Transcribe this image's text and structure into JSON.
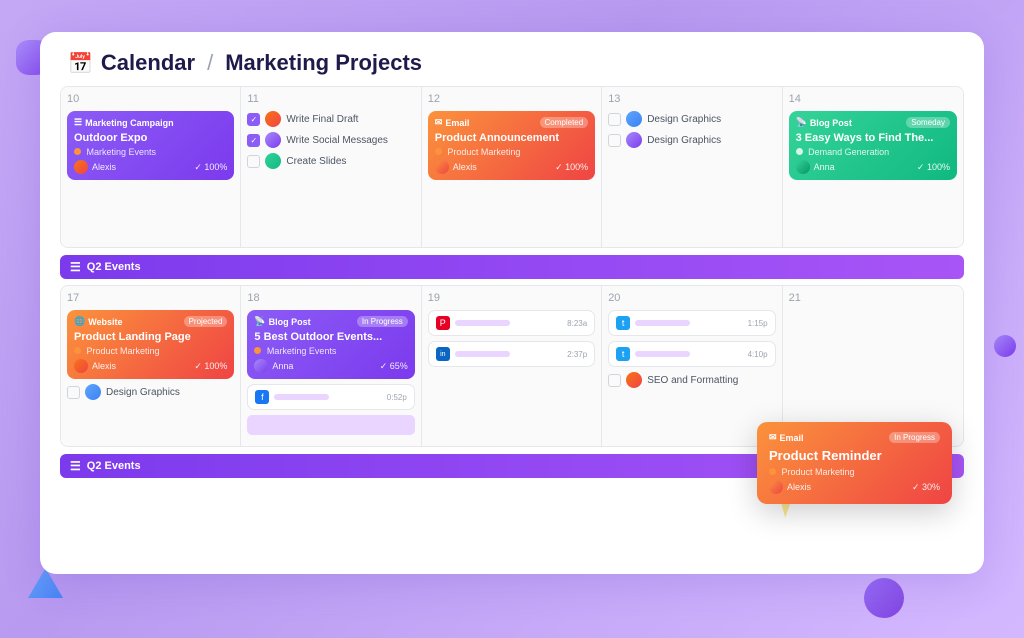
{
  "header": {
    "icon": "📅",
    "breadcrumb_sep": "/",
    "calendar_label": "Calendar",
    "project_label": "Marketing Projects"
  },
  "week1": {
    "days": [
      {
        "num": "10",
        "cards": [
          {
            "type": "purple",
            "icon": "☰",
            "type_label": "Marketing Campaign",
            "title": "Outdoor Expo",
            "sub": "Marketing Events",
            "avatar_name": "Alexis",
            "progress": "100%"
          }
        ]
      },
      {
        "num": "11",
        "checklist": [
          {
            "checked": true,
            "label": "Write Final Draft"
          },
          {
            "checked": true,
            "label": "Write Social Messages"
          },
          {
            "checked": false,
            "label": "Create Slides"
          }
        ]
      },
      {
        "num": "12",
        "cards": [
          {
            "type": "orange",
            "icon": "✉",
            "type_label": "Email",
            "badge": "Completed",
            "title": "Product Announcement",
            "sub": "Product Marketing",
            "avatar_name": "Alexis",
            "progress": "100%"
          }
        ]
      },
      {
        "num": "13",
        "tasks": [
          {
            "label": "Design Graphics"
          },
          {
            "label": "Design Graphics"
          }
        ]
      },
      {
        "num": "14",
        "cards": [
          {
            "type": "green",
            "icon": "📡",
            "type_label": "Blog Post",
            "badge": "Someday",
            "title": "3 Easy Ways to Find The...",
            "sub": "Demand Generation",
            "avatar_name": "Anna",
            "progress": "100%"
          }
        ]
      }
    ],
    "q2_banner": "Q2 Events"
  },
  "week2": {
    "days": [
      {
        "num": "17",
        "cards": [
          {
            "type": "orange",
            "icon": "🌐",
            "type_label": "Website",
            "badge": "Projected",
            "title": "Product Landing Page",
            "sub": "Product Marketing",
            "avatar_name": "Alexis",
            "progress": "100%"
          }
        ],
        "tasks": [
          {
            "label": "Design Graphics"
          }
        ]
      },
      {
        "num": "18",
        "cards": [
          {
            "type": "purple",
            "icon": "📡",
            "type_label": "Blog Post",
            "badge": "In Progress",
            "title": "5 Best Outdoor Events...",
            "sub": "Marketing Events",
            "avatar_name": "Anna",
            "progress": "65%"
          }
        ],
        "sm_cards": [
          {
            "platform": "f",
            "color": "#1877f2",
            "time": "0:52p"
          }
        ]
      },
      {
        "num": "19",
        "sm_cards": [
          {
            "platform": "P",
            "color": "#e60023",
            "time": "8:23a"
          },
          {
            "platform": "in",
            "color": "#0a66c2",
            "time": "2:37p"
          }
        ]
      },
      {
        "num": "20",
        "sm_cards": [
          {
            "platform": "t",
            "color": "#1da1f2",
            "time": "1:15p"
          },
          {
            "platform": "t",
            "color": "#1da1f2",
            "time": "4:10p"
          }
        ],
        "tasks": [
          {
            "label": "SEO and Formatting"
          }
        ]
      },
      {
        "num": "21",
        "note": "popup"
      }
    ],
    "q2_banner": "Q2 Events"
  },
  "popup": {
    "icon": "✉",
    "type_label": "Email",
    "badge": "In Progress",
    "title": "Product Reminder",
    "sub": "Product Marketing",
    "avatar_name": "Alexis",
    "progress": "30%"
  }
}
